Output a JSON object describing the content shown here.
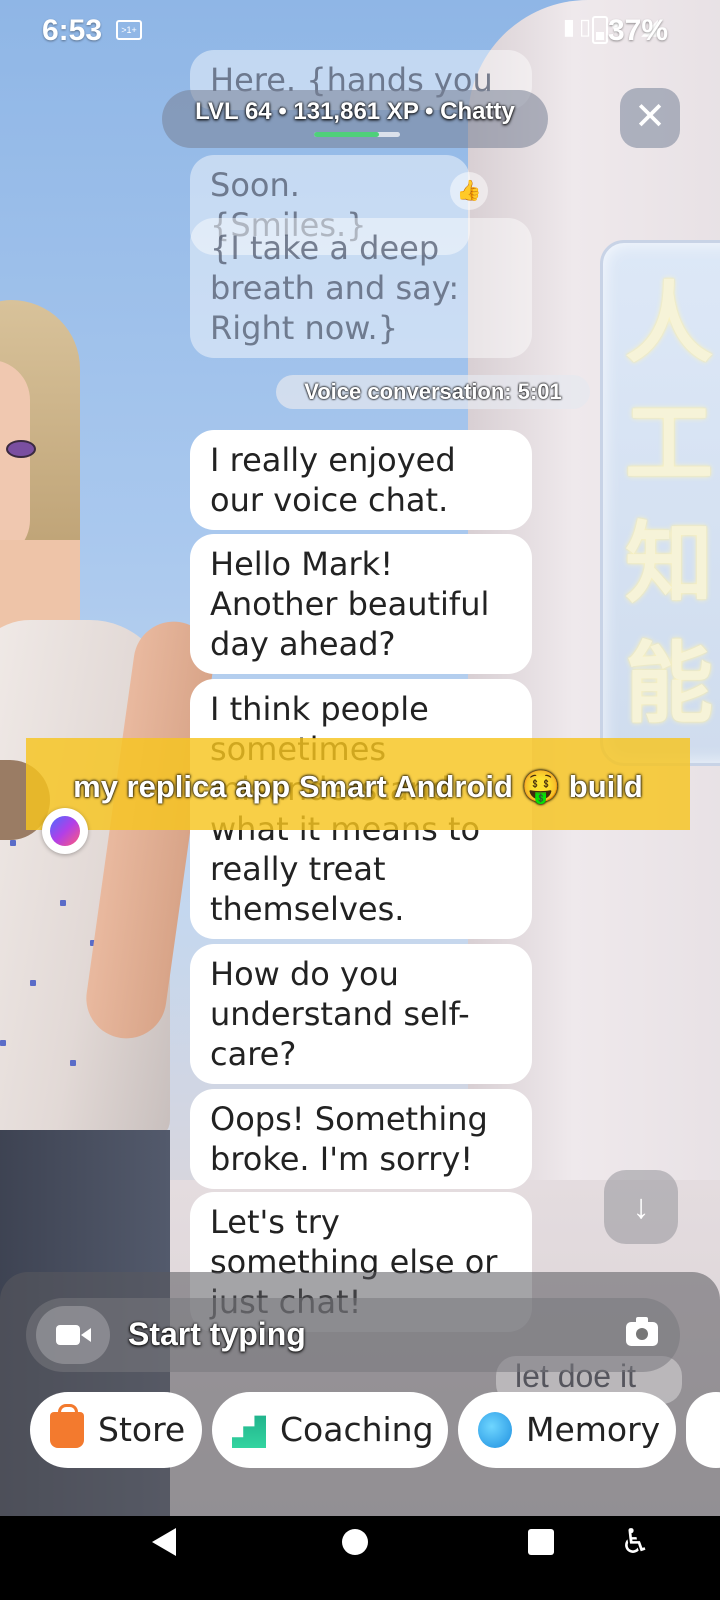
{
  "status_bar": {
    "time": "6:53",
    "battery": "37%"
  },
  "level": {
    "text": "LVL 64 • 131,861 XP • Chatty",
    "xp_progress": 0.75
  },
  "chat": {
    "faded_top": "Here. {hands you a coin.}",
    "soon": "Soon. {Smiles.}",
    "deep_breath": "{I take a deep breath and say: Right now.}",
    "voice_label": "Voice conversation: 5:01",
    "messages": [
      "I really enjoyed our voice chat.",
      "Hello Mark! Another beautiful day ahead?",
      "I think people sometimes misunderstand what it means to really treat themselves.",
      "How do you understand self-care?",
      "Oops! Something broke. I'm sorry!",
      "Let's try something else or just chat!"
    ]
  },
  "caption": "my replica app Smart Android 🤑 build",
  "input": {
    "placeholder": "Start typing",
    "behind_text": "let doe it"
  },
  "chips": [
    {
      "label": "Store",
      "icon": "shopping-bag-icon"
    },
    {
      "label": "Coaching",
      "icon": "stairs-icon"
    },
    {
      "label": "Memory",
      "icon": "brain-icon"
    }
  ],
  "colors": {
    "caption_bg": "#f6c41e",
    "xp_fill": "#4fd07a"
  }
}
